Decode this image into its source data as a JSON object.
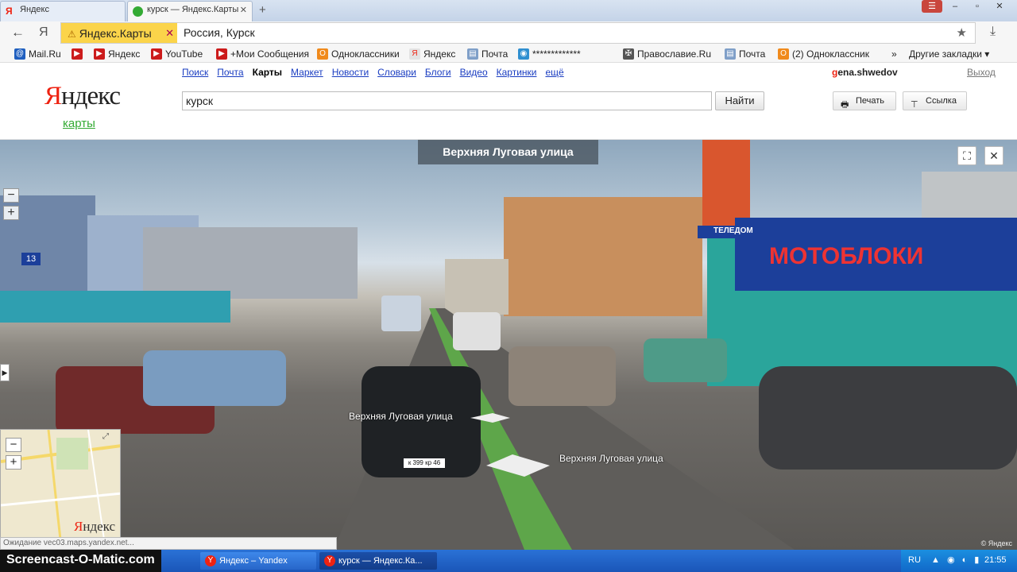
{
  "browser": {
    "tabs": [
      {
        "label": "Яндекс",
        "icon": "yandex-favicon",
        "active": false
      },
      {
        "label": "курск — Яндекс.Карты",
        "icon": "yandex-maps-favicon",
        "active": true
      }
    ],
    "new_tab_label": "+",
    "window_controls": {
      "minimize": "–",
      "restore": "▫",
      "close": "✕"
    },
    "site_chip": "Яндекс.Карты",
    "site_chip_close": "✕",
    "url": "Россия, Курск",
    "back_glyph": "←",
    "ya_glyph": "Я",
    "star_glyph": "★",
    "download_glyph": "⤓"
  },
  "bookmarks": {
    "items": [
      {
        "label": "Mail.Ru",
        "icon": "mailru-icon",
        "color": "#1f5fbf",
        "glyph": "@"
      },
      {
        "label": "",
        "icon": "youtube-icon",
        "color": "#cc1b1b",
        "glyph": "▶"
      },
      {
        "label": "Яндекс",
        "icon": "youtube-icon",
        "color": "#cc1b1b",
        "glyph": "▶"
      },
      {
        "label": "YouTube",
        "icon": "youtube-icon",
        "color": "#cc1b1b",
        "glyph": "▶"
      },
      {
        "label": "+Мои Сообщения",
        "icon": "youtube-icon",
        "color": "#cc1b1b",
        "glyph": "▶"
      },
      {
        "label": "Одноклассники",
        "icon": "odnoklassniki-icon",
        "color": "#f08a1c",
        "glyph": "О"
      },
      {
        "label": "Яндекс",
        "icon": "yandex-icon",
        "color": "#e3e3e3",
        "glyph": "Я"
      },
      {
        "label": "Почта",
        "icon": "page-icon",
        "color": "#7f9fc8",
        "glyph": "▤"
      },
      {
        "label": "*************",
        "icon": "globe-icon",
        "color": "#2f8fd0",
        "glyph": "◉"
      },
      {
        "label": "Православие.Ru",
        "icon": "cross-icon",
        "color": "#555555",
        "glyph": "✠"
      },
      {
        "label": "Почта",
        "icon": "page-icon",
        "color": "#7f9fc8",
        "glyph": "▤"
      },
      {
        "label": "(2) Одноклассник",
        "icon": "odnoklassniki-icon",
        "color": "#f08a1c",
        "glyph": "О"
      }
    ],
    "more_glyph": "»",
    "other_label": "Другие закладки"
  },
  "yandex": {
    "logo_first": "Я",
    "logo_rest": "ндекс",
    "logo_sub": "карты",
    "services": [
      "Поиск",
      "Почта",
      "Карты",
      "Маркет",
      "Новости",
      "Словари",
      "Блоги",
      "Видео",
      "Картинки",
      "ещё"
    ],
    "current_service": "Карты",
    "user_first": "g",
    "user_rest": "ena.shwedov",
    "logout": "Выход",
    "search_value": "курск",
    "find_label": "Найти",
    "print_label": "Печать",
    "link_label": "Ссылка"
  },
  "panorama": {
    "street_title": "Верхняя Луговая улица",
    "label_left": "Верхняя Луговая улица",
    "label_right": "Верхняя Луговая улица",
    "zoom_in": "+",
    "zoom_out": "−",
    "fullscreen_glyph": "⛶",
    "close_glyph": "✕",
    "side_arrow": "▶",
    "copyright": "© Яндекс",
    "billboard": "МОТОБЛОКИ",
    "shop_sign": "ТЕЛЕДОМ",
    "route_number": "13",
    "plate_1": "к 399 кр 46"
  },
  "minimap": {
    "zoom_in": "+",
    "zoom_out": "−",
    "logo_first": "Я",
    "logo_rest": "ндекс",
    "expand_glyph": "⤢"
  },
  "status_bar": "Ожидание vec03.maps.yandex.net...",
  "taskbar": {
    "watermark": "Screencast-O-Matic.com",
    "tasks": [
      {
        "label": "Яндекс – Yandex",
        "active": false
      },
      {
        "label": "курск — Яндекс.Ка...",
        "active": true
      }
    ],
    "lang": "RU",
    "clock": "21:55"
  },
  "colors": {
    "yandex_red": "#e21c1c",
    "maps_green": "#33aa33",
    "link_blue": "#1a3dc1",
    "site_chip_yellow": "#fbd44a",
    "taskbar_blue": "#1a56b8"
  }
}
